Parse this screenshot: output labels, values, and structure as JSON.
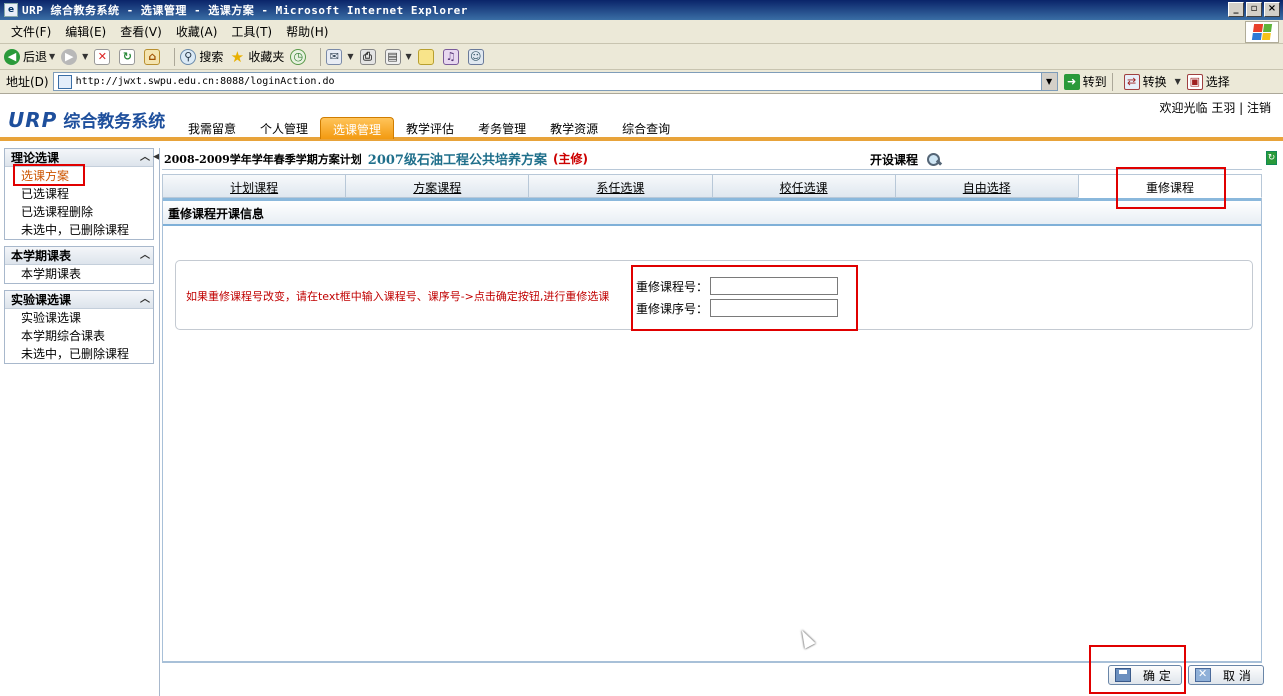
{
  "window": {
    "title": "URP 综合教务系统 - 选课管理 - 选课方案 - Microsoft Internet Explorer",
    "buttons": [
      "_",
      "▫",
      "×"
    ]
  },
  "menubar": {
    "items": [
      "文件(F)",
      "编辑(E)",
      "查看(V)",
      "收藏(A)",
      "工具(T)",
      "帮助(H)"
    ]
  },
  "toolbar": {
    "back": "后退",
    "search": "搜索",
    "favorites": "收藏夹"
  },
  "addressbar": {
    "label": "地址(D)",
    "url": "http://jwxt.swpu.edu.cn:8088/loginAction.do",
    "go": "转到",
    "convert": "转换",
    "select": "选择"
  },
  "header": {
    "logo_urp": "URP",
    "logo_sys": "综合教务系统",
    "welcome": "欢迎光临 王羽 | 注销",
    "nav": [
      "我需留意",
      "个人管理",
      "选课管理",
      "教学评估",
      "考务管理",
      "教学资源",
      "综合查询"
    ],
    "active_nav": "选课管理"
  },
  "sidebar": {
    "groups": [
      {
        "title": "理论选课",
        "items": [
          "选课方案",
          "已选课程",
          "已选课程删除",
          "未选中，已删除课程"
        ]
      },
      {
        "title": "本学期课表",
        "items": [
          "本学期课表"
        ]
      },
      {
        "title": "实验课选课",
        "items": [
          "实验课选课",
          "本学期综合课表",
          "未选中，已删除课程"
        ]
      }
    ],
    "current_item": "选课方案"
  },
  "plan": {
    "term": "2008-2009学年学年春季学期方案计划",
    "name": "2007级石油工程公共培养方案",
    "major": "(主修)",
    "open_course": "开设课程"
  },
  "tabs": [
    "计划课程",
    "方案课程",
    "系任选课",
    "校任选课",
    "自由选择",
    "重修课程"
  ],
  "active_tab": "重修课程",
  "panel": {
    "title": "重修课程开课信息",
    "hint": "如果重修课程号改变，请在text框中输入课程号、课序号->点击确定按钮,进行重修选课",
    "course_no_label": "重修课程号：",
    "course_no_value": "",
    "section_no_label": "重修课序号：",
    "section_no_value": ""
  },
  "buttons": {
    "confirm": "确 定",
    "cancel": "取 消"
  },
  "colors": {
    "accent_orange": "#f39a10",
    "highlight_red": "#e00000",
    "plan_teal": "#1f6f8b",
    "hint_red": "#c00000"
  }
}
